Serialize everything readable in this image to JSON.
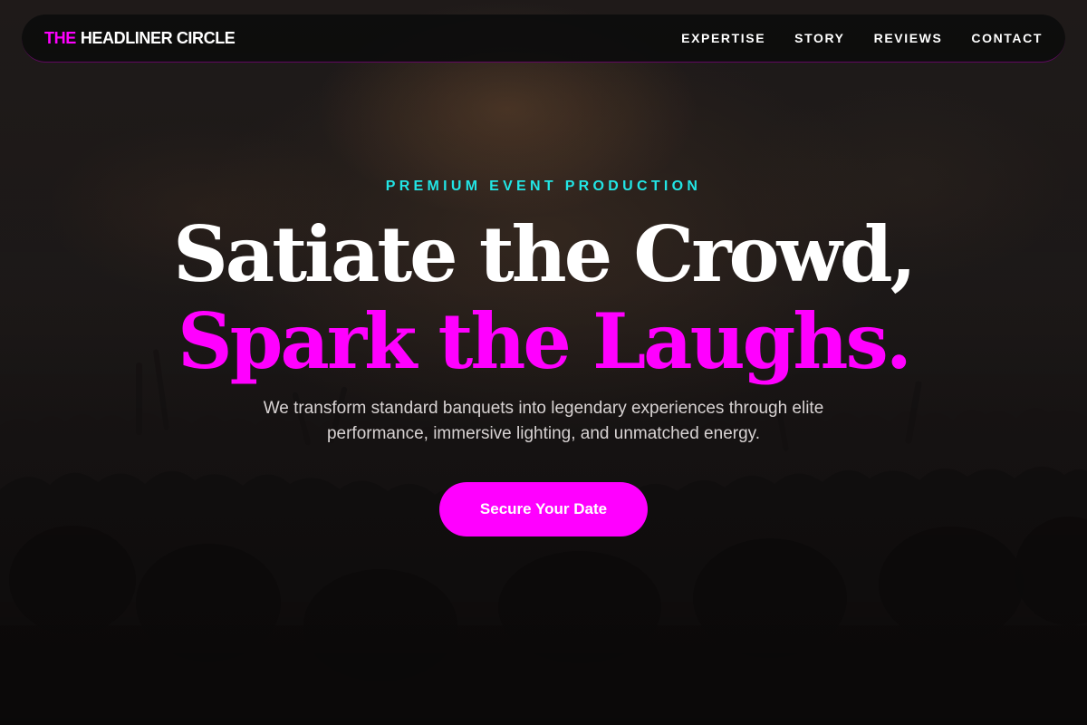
{
  "brand": {
    "accent": "THE",
    "name": "HEADLINER CIRCLE"
  },
  "nav": {
    "links": [
      "EXPERTISE",
      "STORY",
      "REVIEWS",
      "CONTACT"
    ]
  },
  "hero": {
    "eyebrow": "PREMIUM EVENT PRODUCTION",
    "headline_line1": "Satiate the Crowd,",
    "headline_line2": "Spark the Laughs.",
    "subtitle": "We transform standard banquets into legendary experiences through elite performance, immersive lighting, and unmatched energy.",
    "cta_label": "Secure Your Date"
  },
  "colors": {
    "accent_magenta": "#ff00ff",
    "accent_cyan": "#22e5e5",
    "background": "#141213"
  }
}
